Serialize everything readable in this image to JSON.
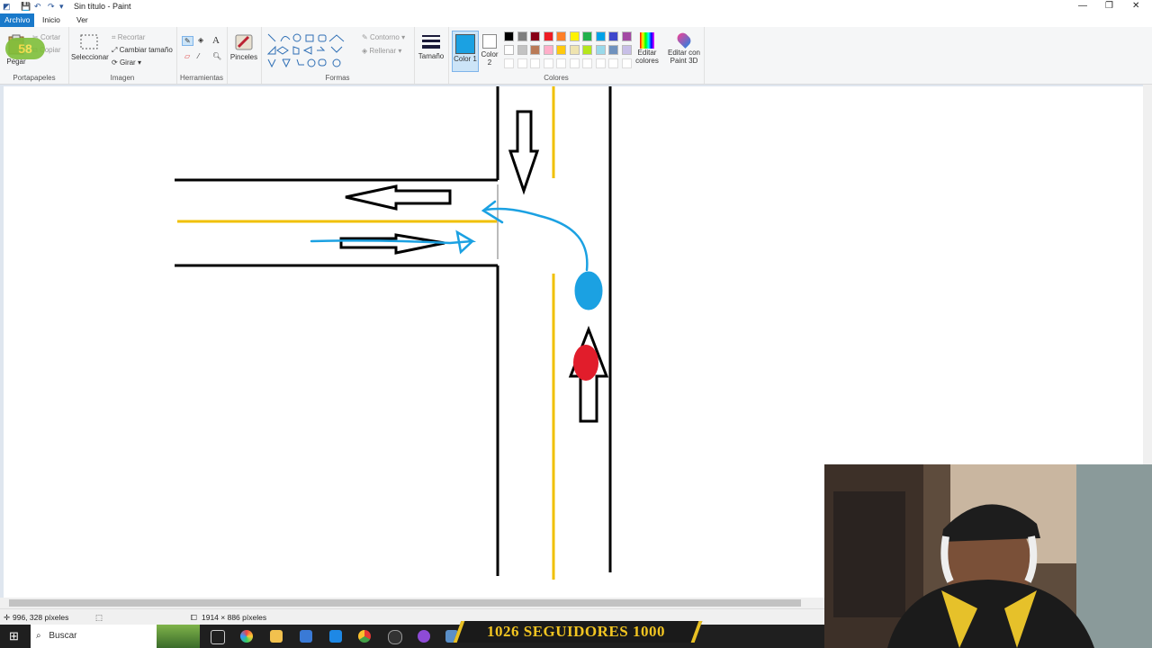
{
  "window": {
    "title": "Sin título - Paint"
  },
  "menu": {
    "archivo": "Archivo",
    "inicio": "Inicio",
    "ver": "Ver"
  },
  "ribbon": {
    "portapapeles": {
      "label": "Portapapeles",
      "pegar": "Pegar",
      "cortar": "Cortar",
      "copiar": "Copiar"
    },
    "imagen": {
      "label": "Imagen",
      "seleccionar": "Seleccionar",
      "recortar": "Recortar",
      "cambiar_tamano": "Cambiar tamaño",
      "girar": "Girar"
    },
    "herramientas": {
      "label": "Herramientas"
    },
    "pinceles": "Pinceles",
    "formas": {
      "label": "Formas",
      "contorno": "Contorno",
      "rellenar": "Rellenar"
    },
    "tamano": "Tamaño",
    "color1": "Color 1",
    "color2": "Color 2",
    "colores": {
      "label": "Colores",
      "editar": "Editar colores",
      "paint3d": "Editar con Paint 3D",
      "row1": [
        "#000000",
        "#7f7f7f",
        "#880015",
        "#ed1c24",
        "#ff7f27",
        "#fff200",
        "#22b14c",
        "#00a2e8",
        "#3f48cc",
        "#a349a4"
      ],
      "row2": [
        "#ffffff",
        "#c3c3c3",
        "#b97a57",
        "#ffaec9",
        "#ffc90e",
        "#efe4b0",
        "#b5e61d",
        "#99d9ea",
        "#7092be",
        "#c8bfe7"
      ],
      "color1_value": "#1ba1e2"
    }
  },
  "status": {
    "cursor": "996, 328 píxeles",
    "size": "1914 × 886 píxeles"
  },
  "taskbar": {
    "search": "Buscar"
  },
  "overlay": {
    "banner": "1026  SEGUIDORES  1000",
    "badge": "58"
  }
}
